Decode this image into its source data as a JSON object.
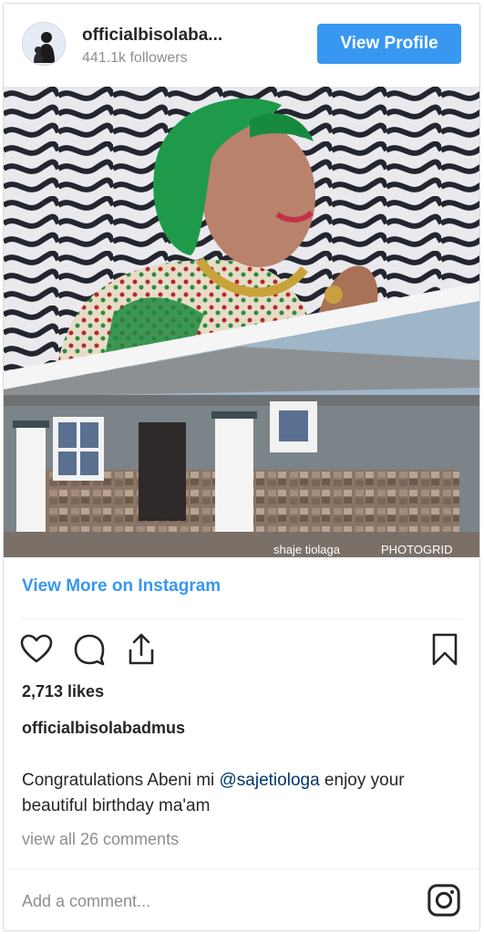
{
  "header": {
    "username": "officialbisolaba...",
    "followers": "441.1k followers",
    "view_profile_label": "View Profile"
  },
  "media": {
    "watermark_left": "shaje tiolaga",
    "watermark_right": "PHOTOGRID",
    "description_icons": [
      "avatar-photo",
      "post-photo"
    ]
  },
  "view_more_label": "View More on Instagram",
  "actions": {
    "icons": [
      "heart-icon",
      "comment-icon",
      "share-icon",
      "bookmark-icon"
    ]
  },
  "likes": "2,713 likes",
  "caption": {
    "owner": "officialbisolabadmus",
    "text_before": "Congratulations Abeni mi ",
    "mention": "@sajetiologa",
    "text_after": " enjoy your beautiful birthday ma'am"
  },
  "view_comments": "view all 26 comments",
  "comment": {
    "placeholder": "Add a comment..."
  },
  "colors": {
    "accent": "#3897f0",
    "mention": "#003569",
    "muted": "#8e8e8e"
  }
}
